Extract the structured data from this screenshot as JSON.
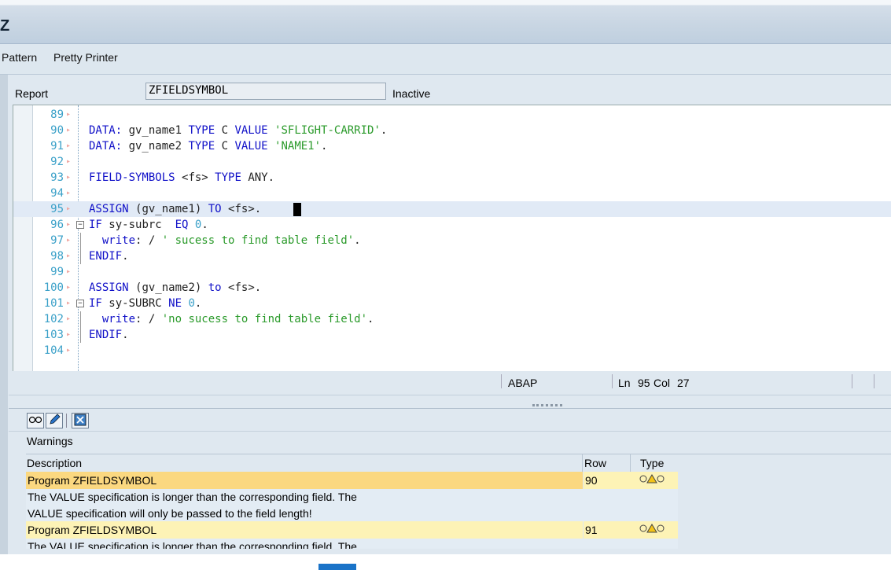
{
  "window": {
    "title_glyph": "Z"
  },
  "toolbar": {
    "pattern_label": "Pattern",
    "pretty_printer_label": "Pretty Printer"
  },
  "report": {
    "label": "Report",
    "name": "ZFIELDSYMBOL",
    "status": "Inactive"
  },
  "editor": {
    "lines": [
      {
        "n": "89",
        "parts": []
      },
      {
        "n": "90",
        "parts": [
          [
            "kw",
            "DATA: "
          ],
          [
            "tx",
            "gv_name1 "
          ],
          [
            "kw",
            "TYPE "
          ],
          [
            "tx",
            "C "
          ],
          [
            "kw",
            "VALUE "
          ],
          [
            "str",
            "'SFLIGHT-CARRID'"
          ],
          [
            "tx",
            "."
          ]
        ]
      },
      {
        "n": "91",
        "parts": [
          [
            "kw",
            "DATA: "
          ],
          [
            "tx",
            "gv_name2 "
          ],
          [
            "kw",
            "TYPE "
          ],
          [
            "tx",
            "C "
          ],
          [
            "kw",
            "VALUE "
          ],
          [
            "str",
            "'NAME1'"
          ],
          [
            "tx",
            "."
          ]
        ]
      },
      {
        "n": "92",
        "parts": []
      },
      {
        "n": "93",
        "parts": [
          [
            "kw",
            "FIELD-SYMBOLS "
          ],
          [
            "tx",
            "<fs> "
          ],
          [
            "kw",
            "TYPE "
          ],
          [
            "tx",
            "ANY."
          ]
        ]
      },
      {
        "n": "94",
        "parts": []
      },
      {
        "n": "95",
        "parts": [
          [
            "kw",
            "ASSIGN "
          ],
          [
            "tx",
            "(gv_name1) "
          ],
          [
            "kw",
            "TO "
          ],
          [
            "tx",
            "<fs>."
          ]
        ]
      },
      {
        "n": "96",
        "parts": [
          [
            "kw",
            "IF "
          ],
          [
            "tx",
            "sy-subrc  "
          ],
          [
            "kw",
            "EQ "
          ],
          [
            "num",
            "0"
          ],
          [
            "tx",
            "."
          ]
        ]
      },
      {
        "n": "97",
        "parts": [
          [
            "tx",
            "  "
          ],
          [
            "kw",
            "write"
          ],
          [
            "tx",
            ": / "
          ],
          [
            "str",
            "' sucess to find table field'"
          ],
          [
            "tx",
            "."
          ]
        ]
      },
      {
        "n": "98",
        "parts": [
          [
            "kw",
            "ENDIF"
          ],
          [
            "tx",
            "."
          ]
        ]
      },
      {
        "n": "99",
        "parts": []
      },
      {
        "n": "100",
        "parts": [
          [
            "kw",
            "ASSIGN "
          ],
          [
            "tx",
            "(gv_name2) "
          ],
          [
            "kw",
            "to "
          ],
          [
            "tx",
            "<fs>."
          ]
        ]
      },
      {
        "n": "101",
        "parts": [
          [
            "kw",
            "IF "
          ],
          [
            "tx",
            "sy-SUBRC "
          ],
          [
            "kw",
            "NE "
          ],
          [
            "num",
            "0"
          ],
          [
            "tx",
            "."
          ]
        ]
      },
      {
        "n": "102",
        "parts": [
          [
            "tx",
            "  "
          ],
          [
            "kw",
            "write"
          ],
          [
            "tx",
            ": / "
          ],
          [
            "str",
            "'no sucess to find table field'"
          ],
          [
            "tx",
            "."
          ]
        ]
      },
      {
        "n": "103",
        "parts": [
          [
            "kw",
            "ENDIF"
          ],
          [
            "tx",
            "."
          ]
        ]
      },
      {
        "n": "104",
        "parts": []
      }
    ]
  },
  "statusbar": {
    "language": "ABAP",
    "ln_label": "Ln",
    "ln": "95",
    "col_label": "Col",
    "col": "27"
  },
  "warnings": {
    "title": "Warnings",
    "columns": {
      "description": "Description",
      "row": "Row",
      "type": "Type"
    },
    "rows": [
      {
        "program": "Program ZFIELDSYMBOL",
        "row": "90",
        "text1": "The VALUE specification is longer than the corresponding field. The",
        "text2": "VALUE specification will only be passed to the field length!"
      },
      {
        "program": "Program ZFIELDSYMBOL",
        "row": "91",
        "text1": "The VALUE specification is longer than the corresponding field. The"
      }
    ]
  },
  "colors": {
    "keyword": "#1010c8",
    "string": "#2a9a2a",
    "number": "#3aa0c8",
    "selected_row": "#fbd880",
    "row_bg": "#fdf3b6"
  }
}
